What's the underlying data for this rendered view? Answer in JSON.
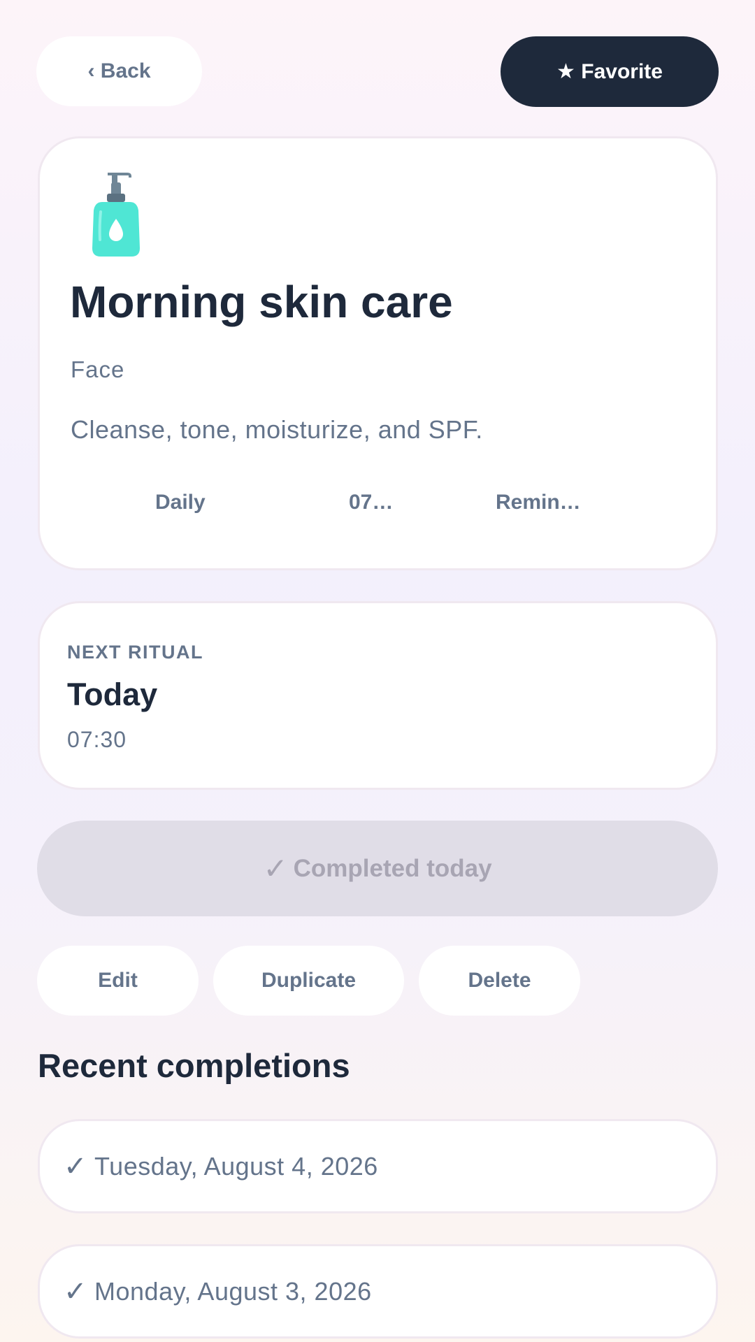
{
  "nav": {
    "back_label": "‹ Back",
    "favorite_label": "★ Favorite"
  },
  "routine": {
    "icon": "lotion-bottle-icon",
    "title": "Morning skin care",
    "category": "Face",
    "description": "Cleanse, tone, moisturize, and SPF.",
    "frequency": "Daily",
    "time_short": "07…",
    "reminder_short": "Remin…"
  },
  "next_ritual": {
    "label": "NEXT RITUAL",
    "day": "Today",
    "time": "07:30"
  },
  "completion_button": {
    "check": "✓",
    "label": "Completed today"
  },
  "actions": {
    "edit_label": "Edit",
    "duplicate_label": "Duplicate",
    "delete_label": "Delete"
  },
  "recent": {
    "title": "Recent completions",
    "items": [
      {
        "check": "✓",
        "date": "Tuesday, August 4, 2026"
      },
      {
        "check": "✓",
        "date": "Monday, August 3, 2026"
      }
    ]
  },
  "colors": {
    "primary_dark": "#1e293b",
    "muted_text": "#64748b",
    "disabled_bg": "#e0dde7",
    "bottle_accent": "#4fe6d4"
  }
}
